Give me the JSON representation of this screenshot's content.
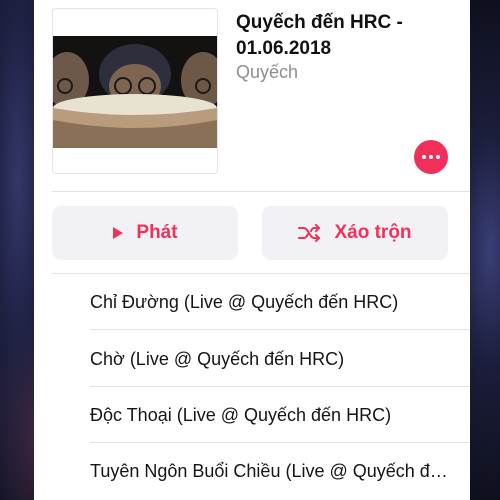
{
  "album": {
    "title": "Quyếch đến HRC - 01.06.2018",
    "artist": "Quyếch",
    "artwork_icon": "album-artwork-image"
  },
  "actions": {
    "play_label": "Phát",
    "play_icon": "play-icon",
    "shuffle_label": "Xáo trộn",
    "shuffle_icon": "shuffle-icon",
    "more_icon": "ellipsis-icon"
  },
  "tracks": [
    {
      "title": "Chỉ Đường (Live @ Quyếch đến HRC)"
    },
    {
      "title": "Chờ (Live @ Quyếch đến HRC)"
    },
    {
      "title": "Độc Thoại (Live @ Quyếch đến HRC)"
    },
    {
      "title": "Tuyên Ngôn Buổi Chiều (Live @ Quyếch đến HRC)"
    }
  ],
  "colors": {
    "accent": "#f0325a",
    "button_bg": "#f2f2f6",
    "secondary_text": "#8e8e93",
    "background": "#0e0f1c"
  }
}
